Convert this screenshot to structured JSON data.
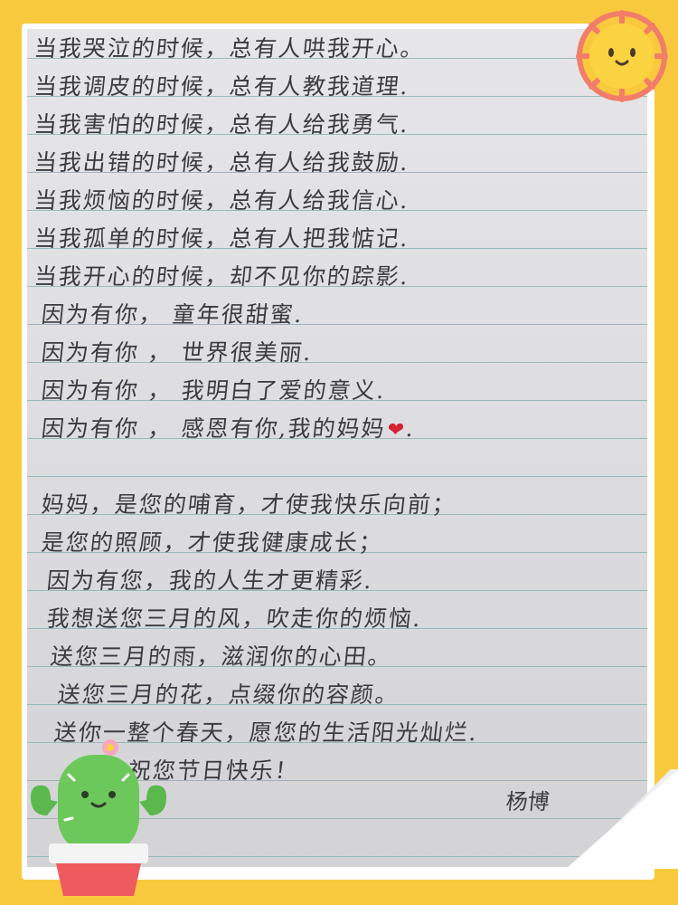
{
  "letter": {
    "lines": [
      "当我哭泣的时候，总有人哄我开心。",
      "当我调皮的时候，总有人教我道理.",
      "当我害怕的时候，总有人给我勇气.",
      "当我出错的时候，总有人给我鼓励.",
      "当我烦恼的时候，总有人给我信心.",
      "当我孤单的时候，总有人把我惦记.",
      "当我开心的时候，却不见你的踪影.",
      "因为有你，  童年很甜蜜.",
      "因为有你 ，  世界很美丽.",
      "因为有你 ，  我明白了爱的意义.",
      "因为有你 ，  感恩有你,我的妈妈",
      "",
      "妈妈，是您的哺育，才使我快乐向前；",
      "是您的照顾，才使我健康成长；",
      "因为有您，我的人生才更精彩.",
      "我想送您三月的风，吹走你的烦恼.",
      "送您三月的雨，滋润你的心田。",
      "送您三月的花，点缀你的容颜。",
      "送你一整个春天，愿您的生活阳光灿烂.",
      "祝您节日快乐！"
    ],
    "heart_symbol": "❤",
    "heart_tail": ".",
    "signature": "杨博"
  },
  "colors": {
    "background": "#f9c93d",
    "ink": "#3a3a40",
    "rule": "#8fb0b6",
    "heart": "#d42232"
  },
  "decorations": {
    "sun_icon": "smiling-sun",
    "cactus_icon": "smiling-cactus-in-pot"
  }
}
